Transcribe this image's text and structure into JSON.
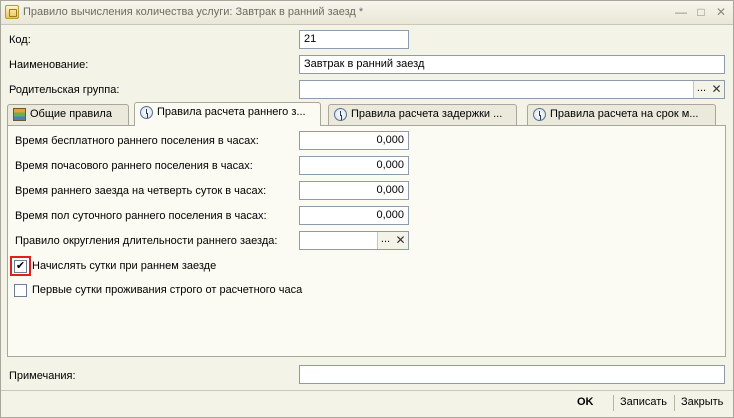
{
  "window": {
    "title": "Правило вычисления количества услуги: Завтрак в ранний заезд *",
    "minimize": "—",
    "maximize": "□",
    "close": "✕"
  },
  "header": {
    "code_label": "Код:",
    "code_value": "21",
    "name_label": "Наименование:",
    "name_value": "Завтрак в ранний заезд",
    "parent_label": "Родительская группа:",
    "parent_value": "",
    "select_glyph": "...",
    "clear_glyph": "✕"
  },
  "tabs": [
    {
      "label": "Общие правила",
      "icon": "stack-icon",
      "active": false
    },
    {
      "label": "Правила расчета раннего з...",
      "icon": "clock-icon",
      "active": true
    },
    {
      "label": "Правила расчета задержки ...",
      "icon": "clock-icon",
      "active": false
    },
    {
      "label": "Правила расчета на срок м...",
      "icon": "clock-icon",
      "active": false
    }
  ],
  "early": {
    "free_label": "Время бесплатного раннего поселения в часах:",
    "free_value": "0,000",
    "hourly_label": "Время почасового раннего поселения в часах:",
    "hourly_value": "0,000",
    "quarter_label": "Время раннего заезда на четверть суток в часах:",
    "quarter_value": "0,000",
    "half_label": "Время пол суточного раннего поселения в часах:",
    "half_value": "0,000",
    "rounding_label": "Правило округления длительности раннего заезда:",
    "rounding_value": "",
    "charge_day_label": "Начислять сутки при раннем заезде",
    "charge_day_checked": true,
    "first_day_label": "Первые сутки проживания строго от расчетного часа",
    "first_day_checked": false,
    "check_glyph": "✔"
  },
  "notes": {
    "label": "Примечания:",
    "value": ""
  },
  "footer": {
    "ok": "OK",
    "save": "Записать",
    "close": "Закрыть"
  }
}
